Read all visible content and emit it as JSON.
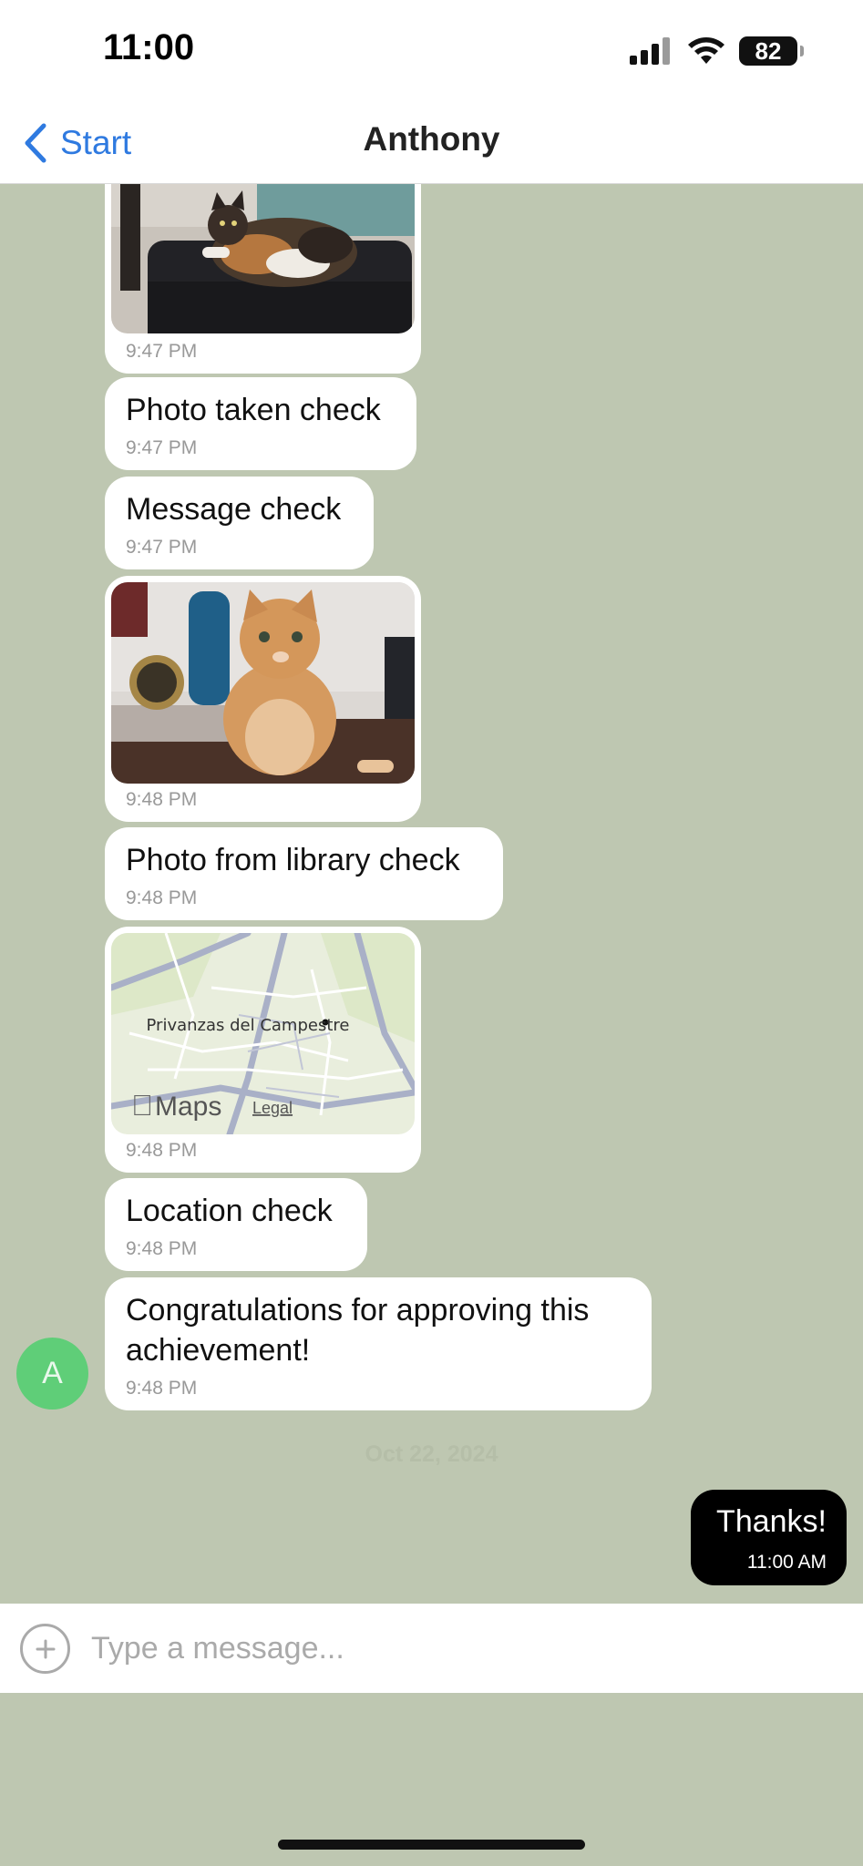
{
  "status": {
    "time": "11:00",
    "battery": "82",
    "icons": [
      "signal-icon",
      "wifi-icon",
      "battery-icon"
    ]
  },
  "nav": {
    "back_label": "Start",
    "title": "Anthony",
    "accent": "#2f7ae0"
  },
  "messages": [
    {
      "type": "photo",
      "description": "calico cat on sofa",
      "time": "9:47 PM"
    },
    {
      "type": "text",
      "text": "Photo taken check",
      "time": "9:47 PM"
    },
    {
      "type": "text",
      "text": "Message check",
      "time": "9:47 PM"
    },
    {
      "type": "photo",
      "description": "orange cat sitting",
      "time": "9:48 PM"
    },
    {
      "type": "text",
      "text": "Photo from library check",
      "time": "9:48 PM"
    },
    {
      "type": "map",
      "place": "Privanzas del Campestre",
      "brand": "Maps",
      "legal": "Legal",
      "time": "9:48 PM"
    },
    {
      "type": "text",
      "text": "Location check",
      "time": "9:48 PM"
    },
    {
      "type": "text",
      "text": "Congratulations for approving this achievement!",
      "time": "9:48 PM"
    }
  ],
  "avatar_initial": "A",
  "date_separator": "Oct 22, 2024",
  "sent": {
    "text": "Thanks!",
    "time": "11:00 AM"
  },
  "composer": {
    "placeholder": "Type a message..."
  },
  "colors": {
    "chat_background": "#bec7b1",
    "received_bubble": "#ffffff",
    "sent_bubble": "#000000",
    "avatar": "#5fce78"
  }
}
